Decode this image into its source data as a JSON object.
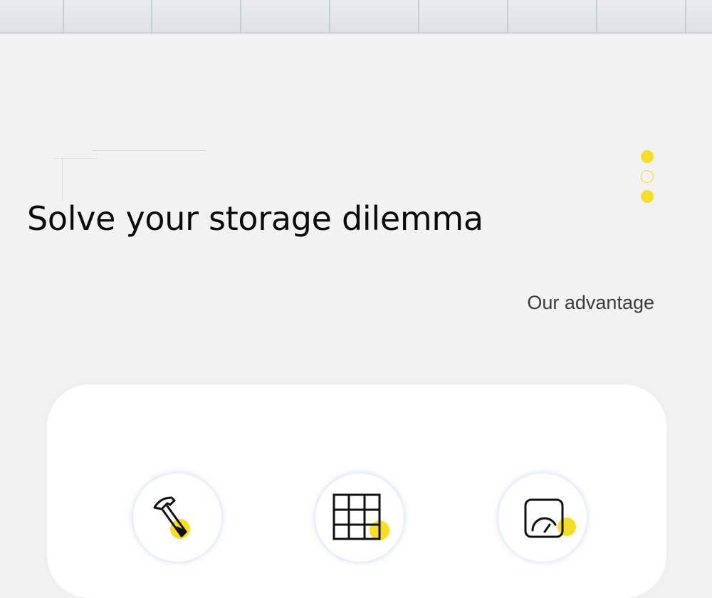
{
  "banner": {
    "headline": "Solve your storage dilemma"
  },
  "section": {
    "subheading": "Our advantage"
  },
  "pagination": {
    "dots": [
      "filled",
      "outline",
      "filled"
    ]
  },
  "features": [
    {
      "icon": "hammer-icon"
    },
    {
      "icon": "grid-icon"
    },
    {
      "icon": "gauge-icon"
    }
  ],
  "colors": {
    "accent": "#f6dd2a",
    "background": "#f2f2f2",
    "card": "#ffffff",
    "text": "#0a0a0a"
  }
}
